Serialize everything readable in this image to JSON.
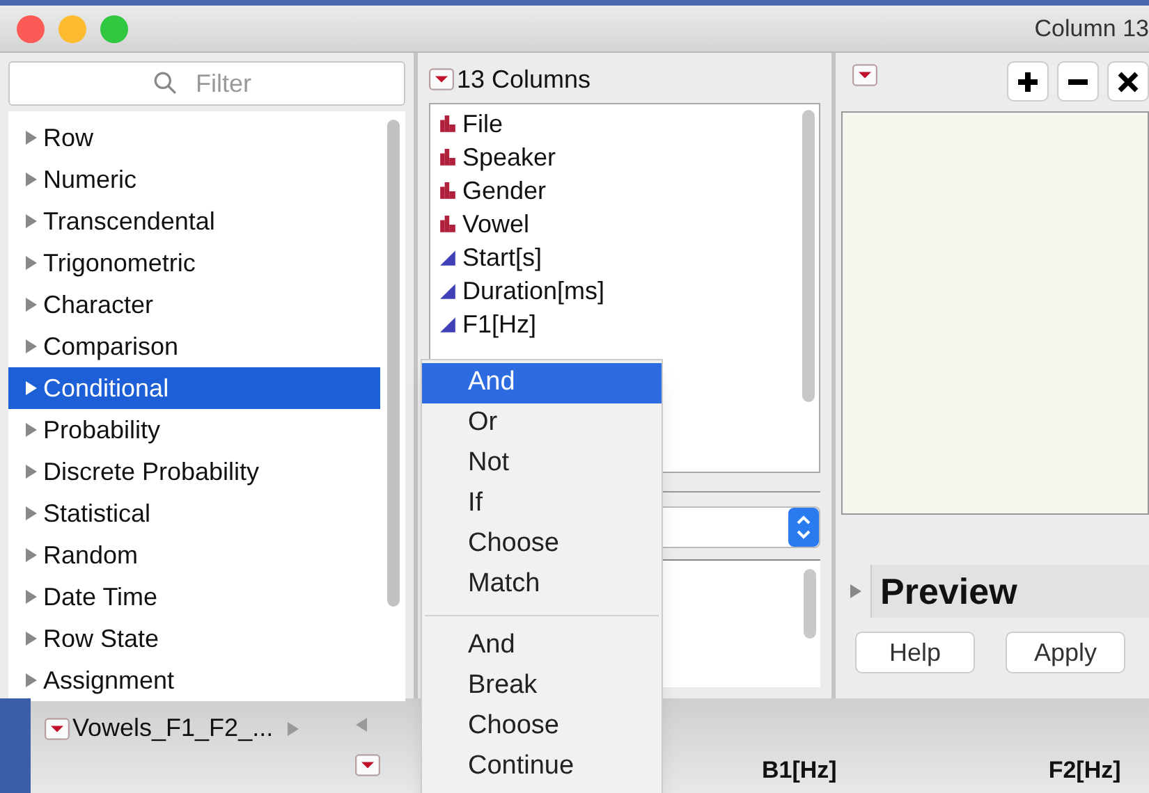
{
  "window": {
    "title": "Column 13"
  },
  "functions": {
    "filter_placeholder": "Filter",
    "categories": [
      {
        "label": "Row",
        "selected": false
      },
      {
        "label": "Numeric",
        "selected": false
      },
      {
        "label": "Transcendental",
        "selected": false
      },
      {
        "label": "Trigonometric",
        "selected": false
      },
      {
        "label": "Character",
        "selected": false
      },
      {
        "label": "Comparison",
        "selected": false
      },
      {
        "label": "Conditional",
        "selected": true
      },
      {
        "label": "Probability",
        "selected": false
      },
      {
        "label": "Discrete Probability",
        "selected": false
      },
      {
        "label": "Statistical",
        "selected": false
      },
      {
        "label": "Random",
        "selected": false
      },
      {
        "label": "Date Time",
        "selected": false
      },
      {
        "label": "Row State",
        "selected": false
      },
      {
        "label": "Assignment",
        "selected": false
      }
    ]
  },
  "columns": {
    "header": "13 Columns",
    "items": [
      {
        "name": "File",
        "kind": "nominal"
      },
      {
        "name": "Speaker",
        "kind": "nominal"
      },
      {
        "name": "Gender",
        "kind": "nominal"
      },
      {
        "name": "Vowel",
        "kind": "nominal"
      },
      {
        "name": "Start[s]",
        "kind": "continuous"
      },
      {
        "name": "Duration[ms]",
        "kind": "continuous"
      },
      {
        "name": "F1[Hz]",
        "kind": "continuous"
      }
    ]
  },
  "popup_menu": {
    "groups": [
      [
        {
          "label": "And",
          "selected": true
        },
        {
          "label": "Or",
          "selected": false
        },
        {
          "label": "Not",
          "selected": false
        },
        {
          "label": "If",
          "selected": false
        },
        {
          "label": "Choose",
          "selected": false
        },
        {
          "label": "Match",
          "selected": false
        }
      ],
      [
        {
          "label": "And",
          "selected": false
        },
        {
          "label": "Break",
          "selected": false
        },
        {
          "label": "Choose",
          "selected": false
        },
        {
          "label": "Continue",
          "selected": false
        }
      ]
    ]
  },
  "editor": {
    "preview_label": "Preview",
    "buttons": [
      "Help",
      "Apply"
    ]
  },
  "background_table": {
    "tab": "Vowels_F1_F2_...",
    "column_headers": [
      "B1[Hz]",
      "F2[Hz]"
    ]
  }
}
